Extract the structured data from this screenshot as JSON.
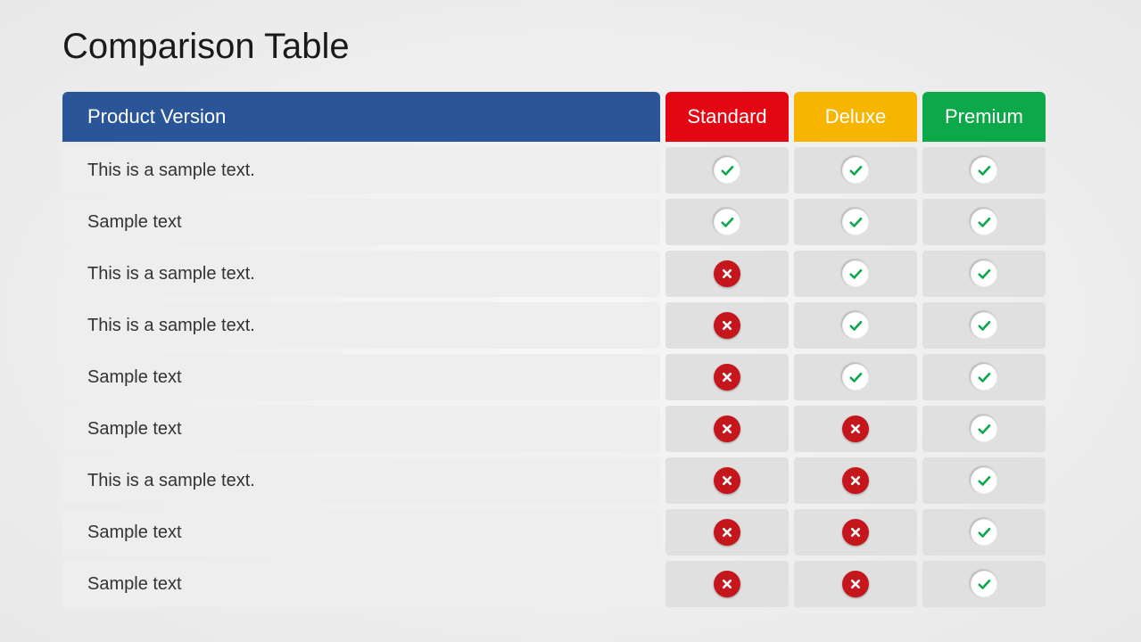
{
  "title": "Comparison Table",
  "header": {
    "feature": "Product Version",
    "standard": "Standard",
    "deluxe": "Deluxe",
    "premium": "Premium"
  },
  "colors": {
    "feature_header": "#2a5699",
    "standard_header": "#e30613",
    "deluxe_header": "#f7b500",
    "premium_header": "#0da84a",
    "check_stroke": "#0da84a",
    "cross_bg": "#c4161c"
  },
  "rows": [
    {
      "label": "This is a sample text.",
      "standard": true,
      "deluxe": true,
      "premium": true
    },
    {
      "label": "Sample text",
      "standard": true,
      "deluxe": true,
      "premium": true
    },
    {
      "label": "This is a sample text.",
      "standard": false,
      "deluxe": true,
      "premium": true
    },
    {
      "label": "This is a sample text.",
      "standard": false,
      "deluxe": true,
      "premium": true
    },
    {
      "label": "Sample text",
      "standard": false,
      "deluxe": true,
      "premium": true
    },
    {
      "label": "Sample text",
      "standard": false,
      "deluxe": false,
      "premium": true
    },
    {
      "label": "This is a sample text.",
      "standard": false,
      "deluxe": false,
      "premium": true
    },
    {
      "label": "Sample text",
      "standard": false,
      "deluxe": false,
      "premium": true
    },
    {
      "label": "Sample text",
      "standard": false,
      "deluxe": false,
      "premium": true
    }
  ]
}
